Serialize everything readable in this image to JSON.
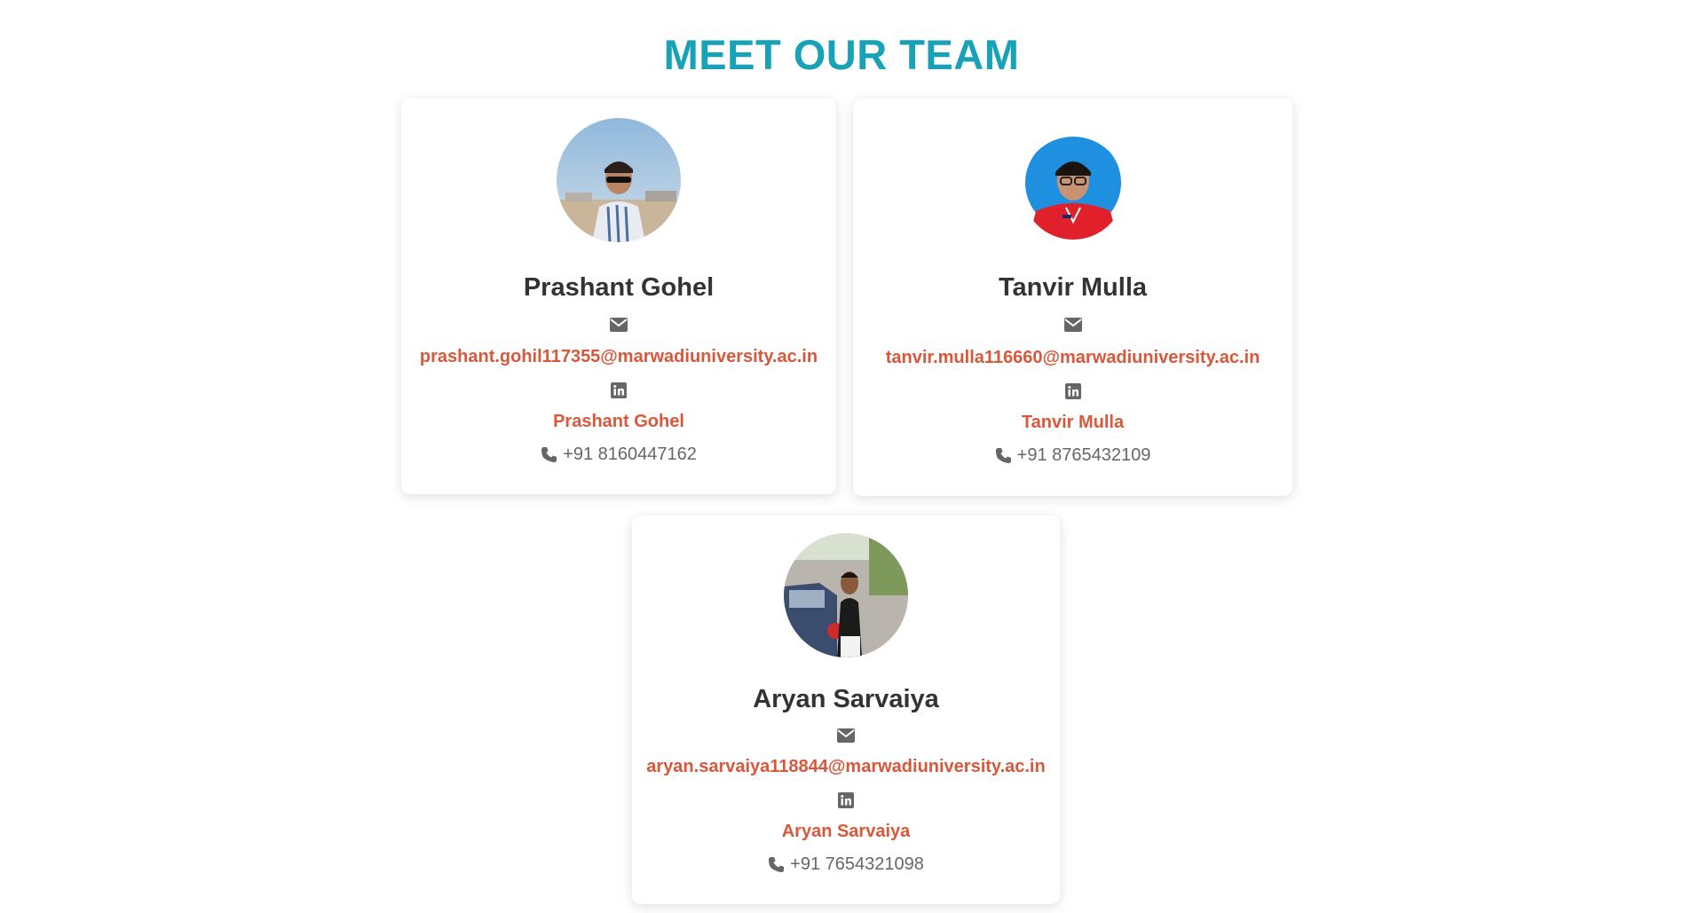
{
  "page": {
    "title": "MEET OUR TEAM"
  },
  "colors": {
    "title": "#17a2b8",
    "link": "#d9573b",
    "name": "#333333",
    "phone": "#666666",
    "icon": "#666666"
  },
  "members": [
    {
      "name": "Prashant Gohel",
      "email": "prashant.gohil117355@marwadiuniversity.ac.in",
      "linkedin_label": "Prashant Gohel",
      "phone": "+91 8160447162",
      "photo": "person-photo-sunglasses-outdoor"
    },
    {
      "name": "Tanvir Mulla",
      "email": "tanvir.mulla116660@marwadiuniversity.ac.in",
      "linkedin_label": "Tanvir Mulla",
      "phone": "+91 8765432109",
      "photo": "person-photo-red-shirt-blue-background"
    },
    {
      "name": "Aryan Sarvaiya",
      "email": "aryan.sarvaiya118844@marwadiuniversity.ac.in",
      "linkedin_label": "Aryan Sarvaiya",
      "phone": "+91 7654321098",
      "photo": "person-photo-car-street"
    }
  ],
  "icons": {
    "email": "envelope-icon",
    "linkedin": "linkedin-icon",
    "phone": "phone-icon"
  }
}
